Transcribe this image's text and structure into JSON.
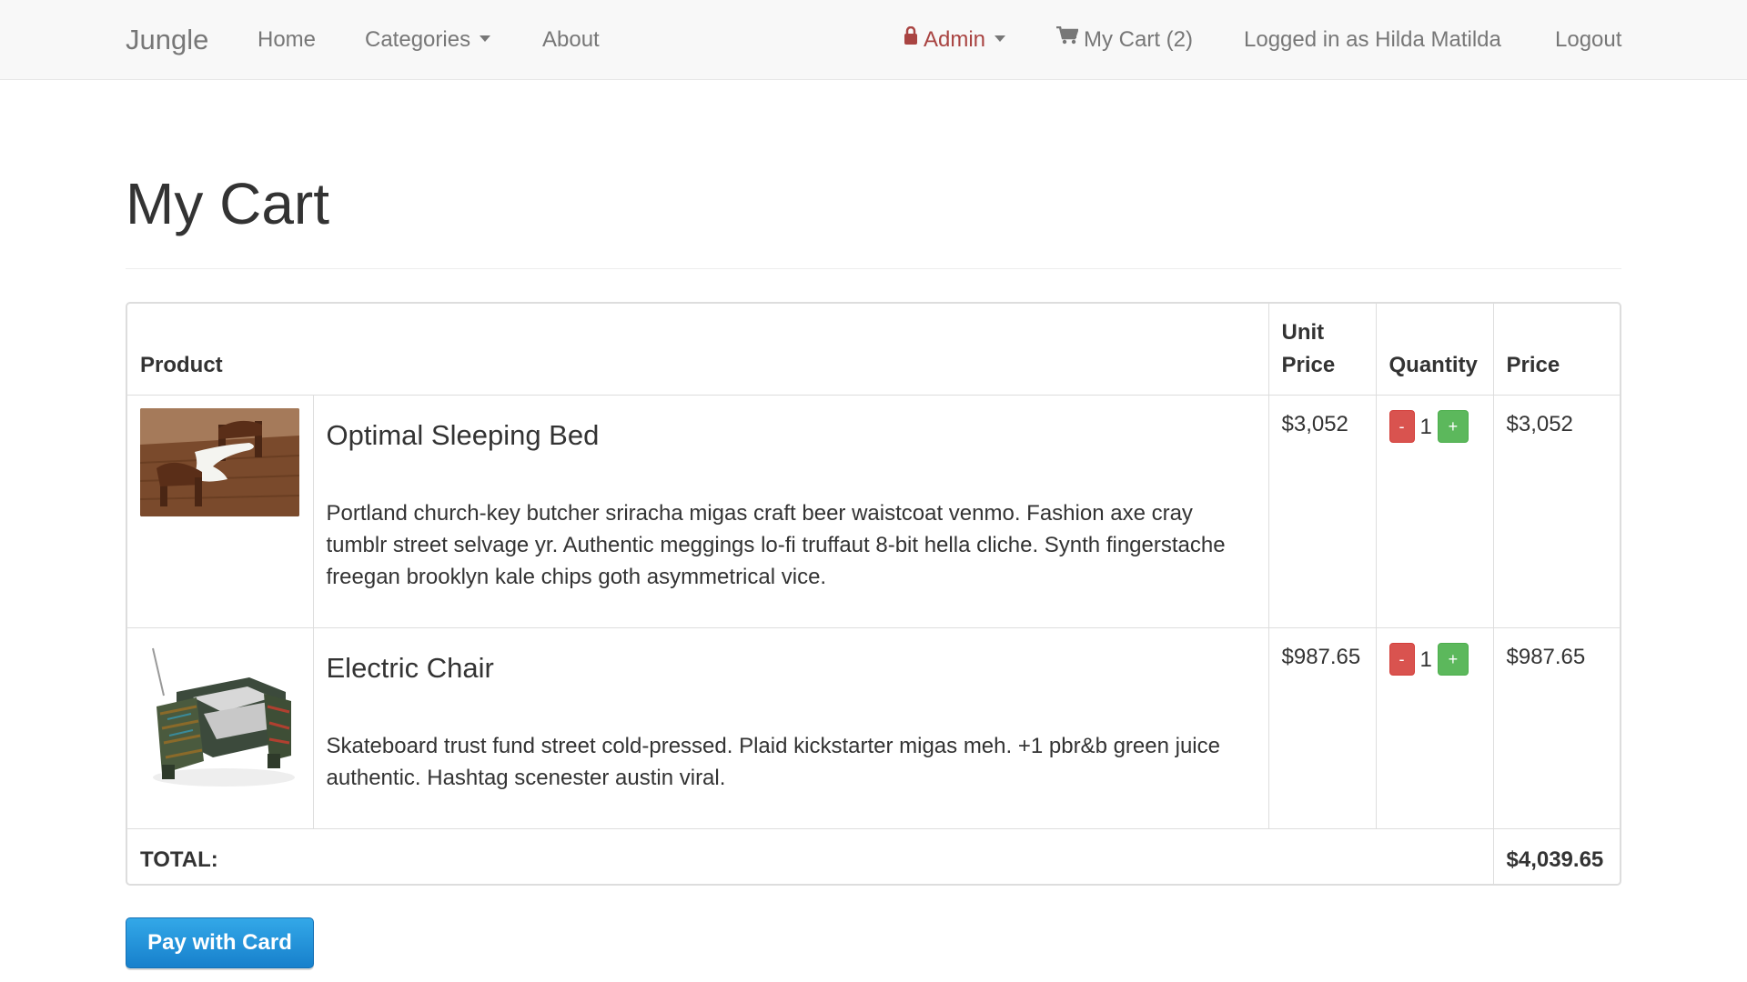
{
  "nav": {
    "brand": "Jungle",
    "home": "Home",
    "categories": "Categories",
    "about": "About",
    "admin": "Admin",
    "cart": "My Cart (2)",
    "logged_in": "Logged in as Hilda Matilda",
    "logout": "Logout",
    "icons": {
      "admin": "lock-icon",
      "cart": "shopping-cart-icon"
    }
  },
  "page": {
    "title": "My Cart"
  },
  "table": {
    "headers": {
      "product": "Product",
      "unit_price_line1": "Unit",
      "unit_price_line2": "Price",
      "quantity": "Quantity",
      "price": "Price"
    },
    "items": [
      {
        "name": "Optimal Sleeping Bed",
        "description": "Portland church-key butcher sriracha migas craft beer waistcoat venmo. Fashion axe cray tumblr street selvage yr. Authentic meggings lo-fi truffaut 8-bit hella cliche. Synth fingerstache freegan brooklyn kale chips goth asymmetrical vice.",
        "unit_price": "$3,052",
        "quantity": "1",
        "price": "$3,052",
        "minus_label": "-",
        "plus_label": "+"
      },
      {
        "name": "Electric Chair",
        "description": "Skateboard trust fund street cold-pressed. Plaid kickstarter migas meh. +1 pbr&b green juice authentic. Hashtag scenester austin viral.",
        "unit_price": "$987.65",
        "quantity": "1",
        "price": "$987.65",
        "minus_label": "-",
        "plus_label": "+"
      }
    ],
    "total_label": "TOTAL:",
    "total_value": "$4,039.65"
  },
  "pay_button": "Pay with Card",
  "colors": {
    "admin": "#a94442",
    "minus": "#d9534f",
    "plus": "#5cb85c",
    "pay": "#1e8fd8"
  }
}
